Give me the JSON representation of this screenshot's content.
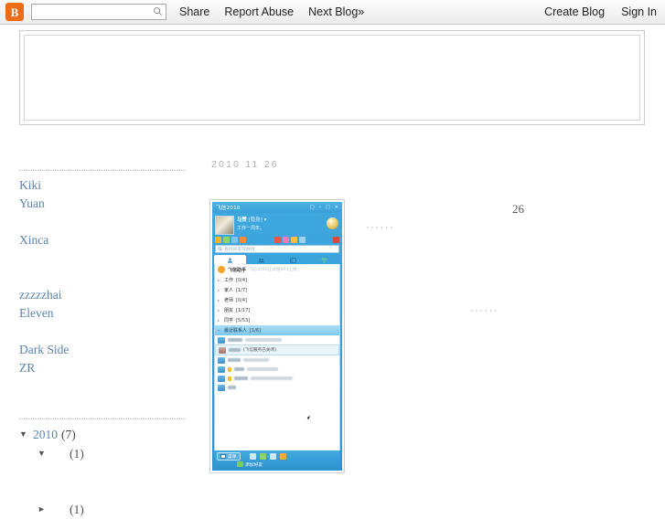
{
  "navbar": {
    "logo_letter": "B",
    "logo_icon": "blogger-logo-icon",
    "search": {
      "value": "",
      "placeholder": ""
    },
    "links": [
      {
        "label": "Share",
        "name": "share"
      },
      {
        "label": "Report Abuse",
        "name": "report-abuse"
      },
      {
        "label": "Next Blog»",
        "name": "next-blog"
      }
    ],
    "right_links": [
      {
        "label": "Create Blog",
        "name": "create-blog"
      },
      {
        "label": "Sign In",
        "name": "sign-in"
      }
    ]
  },
  "sidebar": {
    "links": [
      {
        "label": "Kiki"
      },
      {
        "label": "Yuan"
      },
      {
        "label": "Xinca"
      },
      {
        "label": "zzzzzhai"
      },
      {
        "label": "Eleven"
      },
      {
        "label": "Dark Side"
      },
      {
        "label": "ZR"
      }
    ]
  },
  "archive": {
    "year_label": "2010",
    "year_count": "(7)",
    "triangle_open": "▼",
    "triangle_closed": "►",
    "items": [
      {
        "label": "",
        "count": "(1)",
        "state": "open"
      },
      {
        "label": "",
        "count": "(1)",
        "state": "closed"
      }
    ]
  },
  "post": {
    "date": "2010 11 26",
    "day_number": "26",
    "ellipsis_top": "······",
    "ellipsis_mid": "······"
  },
  "fetion": {
    "title": "飞信2010",
    "window_buttons": [
      "□",
      "–",
      "□",
      "✕"
    ],
    "user_name": "马赞",
    "user_status": "[隐身]",
    "user_status_arrow": "▾",
    "user_mood": "工作一周年。",
    "search_placeholder": "查找好友或群组",
    "tabs": [
      {
        "icon": "contacts-icon",
        "active": true
      },
      {
        "icon": "groups-icon",
        "active": false
      },
      {
        "icon": "phonebook-icon",
        "active": false
      },
      {
        "icon": "wifi-icon",
        "active": false
      }
    ],
    "assistant": {
      "name": "飞信助手",
      "message": "飞信2010正式版SP3上线…"
    },
    "groups": [
      {
        "label": "工作",
        "count": "[0/4]",
        "expanded": false
      },
      {
        "label": "家人",
        "count": "[1/7]",
        "expanded": false
      },
      {
        "label": "老师",
        "count": "[0/4]",
        "expanded": false
      },
      {
        "label": "朋友",
        "count": "[1/17]",
        "expanded": false
      },
      {
        "label": "同学",
        "count": "[5/53]",
        "expanded": false
      },
      {
        "label": "最近联系人",
        "count": "[1/6]",
        "expanded": true
      }
    ],
    "contacts": [
      {
        "name_w": 16,
        "msg_w": 40,
        "badge": false,
        "offline": false,
        "highlight": false,
        "note": ""
      },
      {
        "name_w": 13,
        "msg_w": 0,
        "badge": false,
        "offline": true,
        "highlight": true,
        "note": "[飞信服务已关闭]"
      },
      {
        "name_w": 14,
        "msg_w": 28,
        "badge": false,
        "offline": false,
        "highlight": false,
        "note": ""
      },
      {
        "name_w": 11,
        "msg_w": 34,
        "badge": true,
        "offline": false,
        "highlight": false,
        "note": ""
      },
      {
        "name_w": 15,
        "msg_w": 46,
        "badge": true,
        "offline": false,
        "highlight": false,
        "note": ""
      },
      {
        "name_w": 9,
        "msg_w": 0,
        "badge": false,
        "offline": false,
        "highlight": false,
        "note": ""
      }
    ],
    "bottom": {
      "menu_label": "菜单",
      "add_friend_label": "添加好友"
    }
  },
  "colors": {
    "blogger_orange": "#ef6c16",
    "link_blue": "#5a83ad",
    "fetion_blue": "#3aa0d8",
    "selected_row": "#7ec8ef"
  }
}
